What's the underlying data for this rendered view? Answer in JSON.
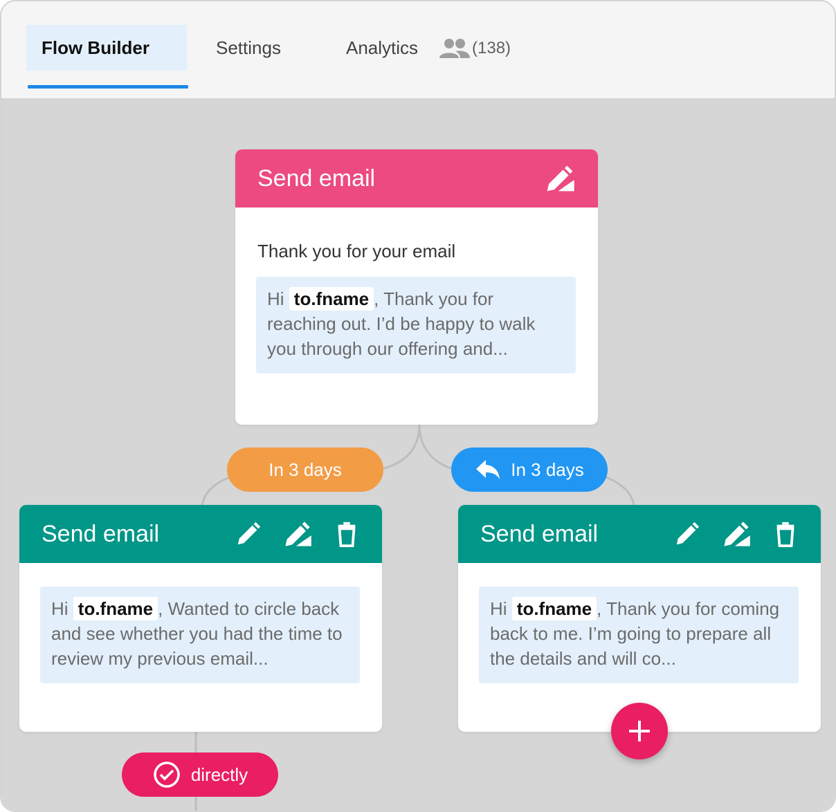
{
  "tabs": [
    {
      "label": "Flow Builder"
    },
    {
      "label": "Settings"
    },
    {
      "label": "Analytics"
    }
  ],
  "analytics_count": "(138)",
  "cards": {
    "top": {
      "title": "Send email",
      "subject": "Thank you for your email",
      "greeting": "Hi",
      "token": "to.fname",
      "body_after": ",  Thank you for reaching out. I’d be happy to walk you through our offering and..."
    },
    "left": {
      "title": "Send email",
      "greeting": "Hi",
      "token": "to.fname",
      "body_after": ",  Wanted to circle back and see whether you had the time to review my previous email..."
    },
    "right": {
      "title": "Send email",
      "greeting": "Hi",
      "token": "to.fname",
      "body_after": ",  Thank you for coming back to me. I’m going to prepare all the details and will co..."
    }
  },
  "delays": {
    "left": "In 3 days",
    "right": "In 3 days",
    "bottom": "directly"
  },
  "colors": {
    "tab_underline": "#1e88e5",
    "tab_active_bg": "#e3f0fb",
    "pink_header": "#ec4a80",
    "teal_header": "#009688",
    "orange_pill": "#f39c46",
    "blue_pill": "#2196f3",
    "red_pill": "#e91e63",
    "message_bg": "#e3f0fb"
  },
  "icons": {
    "people": "people-icon",
    "sign": "signature-icon",
    "edit": "pencil-icon",
    "delete": "trash-icon",
    "reply": "reply-icon",
    "check": "check-circle-icon",
    "add": "plus-icon"
  }
}
